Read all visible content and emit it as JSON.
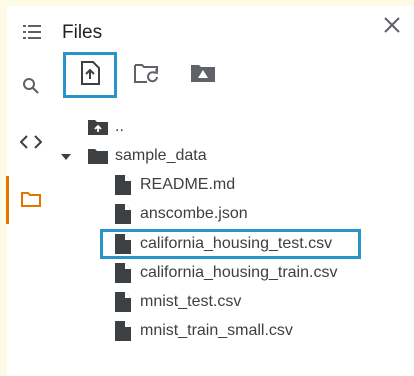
{
  "panel": {
    "title": "Files"
  },
  "rail": {
    "items": [
      "table-of-contents-icon",
      "search-icon",
      "code-snippets-icon",
      "files-icon"
    ],
    "active": "files"
  },
  "toolbar": {
    "tools": [
      "upload-icon",
      "refresh-folder-icon",
      "drive-mount-icon"
    ],
    "selected": "upload"
  },
  "tree": {
    "parent": "..",
    "folder": "sample_data",
    "files": [
      "README.md",
      "anscombe.json",
      "california_housing_test.csv",
      "california_housing_train.csv",
      "mnist_test.csv",
      "mnist_train_small.csv"
    ],
    "selected_file": "california_housing_test.csv"
  },
  "colors": {
    "background": "#fdfbe6",
    "highlight": "#2a93c9",
    "active_tab": "#e37400",
    "icon": "#5f6368"
  }
}
